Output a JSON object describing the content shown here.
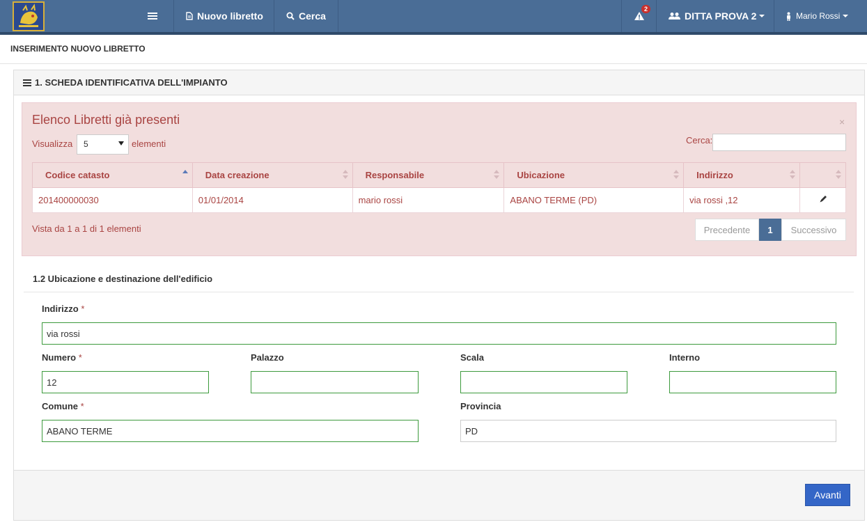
{
  "nav": {
    "items": {
      "menu_icon": "hamburger-icon",
      "new": "Nuovo libretto",
      "search": "Cerca",
      "alerts_count": "2",
      "company": "DITTA PROVA 2",
      "user": "Mario Rossi"
    },
    "colors": {
      "bar": "#4a6d96",
      "accent": "#3466c7"
    }
  },
  "page": {
    "title": "INSERIMENTO NUOVO LIBRETTO"
  },
  "panel": {
    "title": "1. SCHEDA IDENTIFICATIVA DELL'IMPIANTO"
  },
  "alert": {
    "title": "Elenco Libretti già presenti",
    "close": "×",
    "show_prefix": "Visualizza",
    "show_value": "5",
    "show_suffix": "elementi",
    "search_label": "Cerca:",
    "columns": [
      "Codice catasto",
      "Data creazione",
      "Responsabile",
      "Ubicazione",
      "Indirizzo"
    ],
    "rows": [
      {
        "codice": "201400000030",
        "data": "01/01/2014",
        "responsabile": "mario rossi",
        "ubicazione": "ABANO TERME (PD)",
        "indirizzo": "via rossi ,12"
      }
    ],
    "info": "Vista da 1 a 1 di 1 elementi",
    "pager": {
      "prev": "Precedente",
      "page": "1",
      "next": "Successivo"
    }
  },
  "form": {
    "section": "1.2 Ubicazione e destinazione dell'edificio",
    "indirizzo": {
      "label": "Indirizzo",
      "value": "via rossi"
    },
    "numero": {
      "label": "Numero",
      "value": "12"
    },
    "palazzo": {
      "label": "Palazzo",
      "value": ""
    },
    "scala": {
      "label": "Scala",
      "value": ""
    },
    "interno": {
      "label": "Interno",
      "value": ""
    },
    "comune": {
      "label": "Comune",
      "value": "ABANO TERME"
    },
    "provincia": {
      "label": "Provincia",
      "value": "PD"
    },
    "required_mark": "*"
  },
  "footer": {
    "next": "Avanti"
  }
}
